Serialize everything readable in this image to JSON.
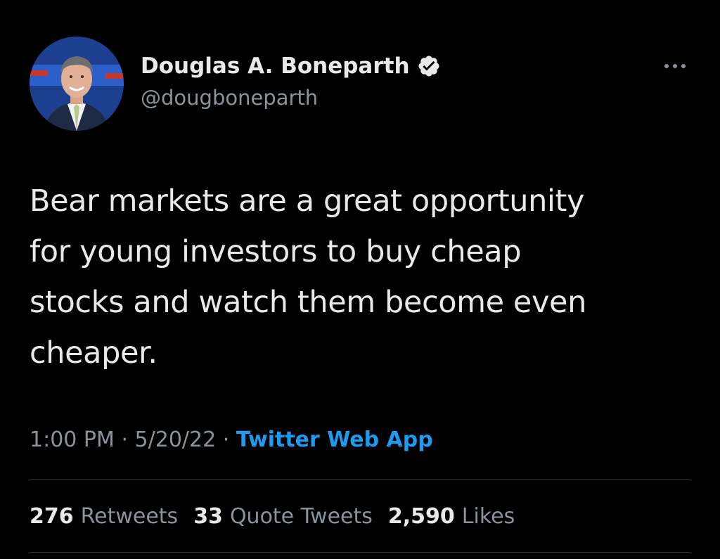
{
  "tweet": {
    "author": {
      "display_name": "Douglas A. Boneparth",
      "handle": "@dougboneparth",
      "verified": true,
      "avatar_icon": "avatar-photo"
    },
    "more_icon": "more-horizontal-icon",
    "text": "Bear markets are a great opportunity\nfor young investors to buy cheap\nstocks and watch them become even\ncheaper.",
    "meta": {
      "time": "1:00 PM",
      "separator1": "·",
      "date": "5/20/22",
      "separator2": "·",
      "source": "Twitter Web App"
    },
    "stats": {
      "retweets_count": "276",
      "retweets_label": "Retweets",
      "quotes_count": "33",
      "quotes_label": "Quote Tweets",
      "likes_count": "2,590",
      "likes_label": "Likes"
    }
  },
  "colors": {
    "background": "#000000",
    "primary_text": "#e7e9ea",
    "secondary_text": "#8b9299",
    "link": "#1d9bf0",
    "divider": "#2f3336"
  }
}
